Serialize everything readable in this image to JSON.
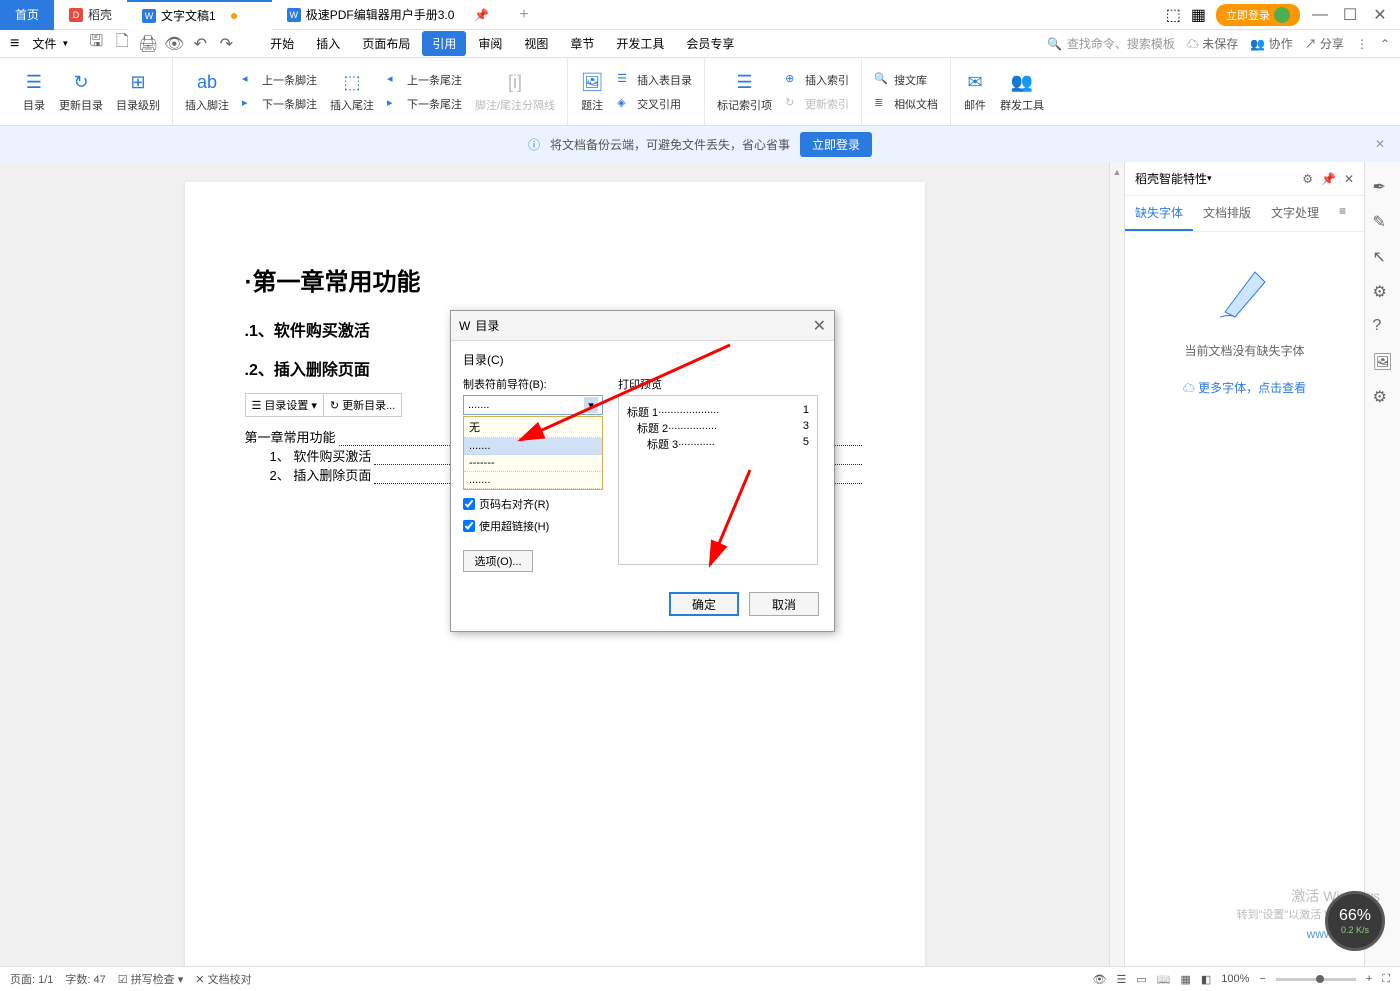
{
  "titlebar": {
    "home": "首页",
    "docke": "稻壳",
    "doc1": "文字文稿1",
    "doc2": "极速PDF编辑器用户手册3.0",
    "login": "立即登录"
  },
  "menubar": {
    "file": "文件",
    "tabs": [
      "开始",
      "插入",
      "页面布局",
      "引用",
      "审阅",
      "视图",
      "章节",
      "开发工具",
      "会员专享"
    ],
    "active_tab": "引用",
    "search_placeholder": "查找命令、搜索模板",
    "unsaved": "未保存",
    "collab": "协作",
    "share": "分享"
  },
  "ribbon": {
    "toc": "目录",
    "update_toc": "更新目录",
    "toc_level": "目录级别",
    "insert_footnote": "插入脚注",
    "prev_footnote": "上一条脚注",
    "next_footnote": "下一条脚注",
    "insert_endnote": "插入尾注",
    "prev_endnote": "上一条尾注",
    "next_endnote": "下一条尾注",
    "footnote_sep": "脚注/尾注分隔线",
    "caption": "题注",
    "insert_fig_toc": "插入表目录",
    "cross_ref": "交叉引用",
    "mark_index": "标记索引项",
    "insert_index": "插入索引",
    "update_index": "更新索引",
    "search_lib": "搜文库",
    "similar_doc": "相似文档",
    "mail": "邮件",
    "group_tool": "群发工具"
  },
  "banner": {
    "text": "将文档备份云端，可避免文件丢失，省心省事",
    "btn": "立即登录"
  },
  "document": {
    "h1": "第一章常用功能",
    "h2_1": "1、软件购买激活",
    "h2_2": "2、插入删除页面",
    "toc_settings": "目录设置",
    "update_toc_btn": "更新目录...",
    "toc": {
      "l1": "第一章常用功能",
      "l2": "1、 软件购买激活",
      "l3": "2、 插入删除页面"
    }
  },
  "dialog": {
    "title": "目录",
    "toc_c": "目录(C)",
    "leader_label": "制表符前导符(B):",
    "leader_value": ".......",
    "leader_options": [
      "无",
      ".......",
      "-------",
      ".......",
      "......."
    ],
    "preview_label": "打印预览",
    "preview_lines": [
      {
        "t": "标题 1",
        "p": "1"
      },
      {
        "t": "标题 2",
        "p": "3"
      },
      {
        "t": "标题 3",
        "p": "5"
      }
    ],
    "right_align": "页码右对齐(R)",
    "hyperlink": "使用超链接(H)",
    "options": "选项(O)...",
    "ok": "确定",
    "cancel": "取消"
  },
  "right_panel": {
    "title": "稻壳智能特性",
    "tabs": [
      "缺失字体",
      "文档排版",
      "文字处理"
    ],
    "msg": "当前文档没有缺失字体",
    "link": "更多字体，点击查看"
  },
  "statusbar": {
    "page": "页面: 1/1",
    "words": "字数: 47",
    "spell": "拼写检查",
    "proofing": "文档校对",
    "zoom": "100%"
  },
  "watermark": {
    "l1": "激活 Windows",
    "l2": "转到\"设置\"以激活 Windows。",
    "site": "www.xz7.com"
  },
  "speed": {
    "pct": "66%",
    "rate": "0.2 K/s"
  }
}
